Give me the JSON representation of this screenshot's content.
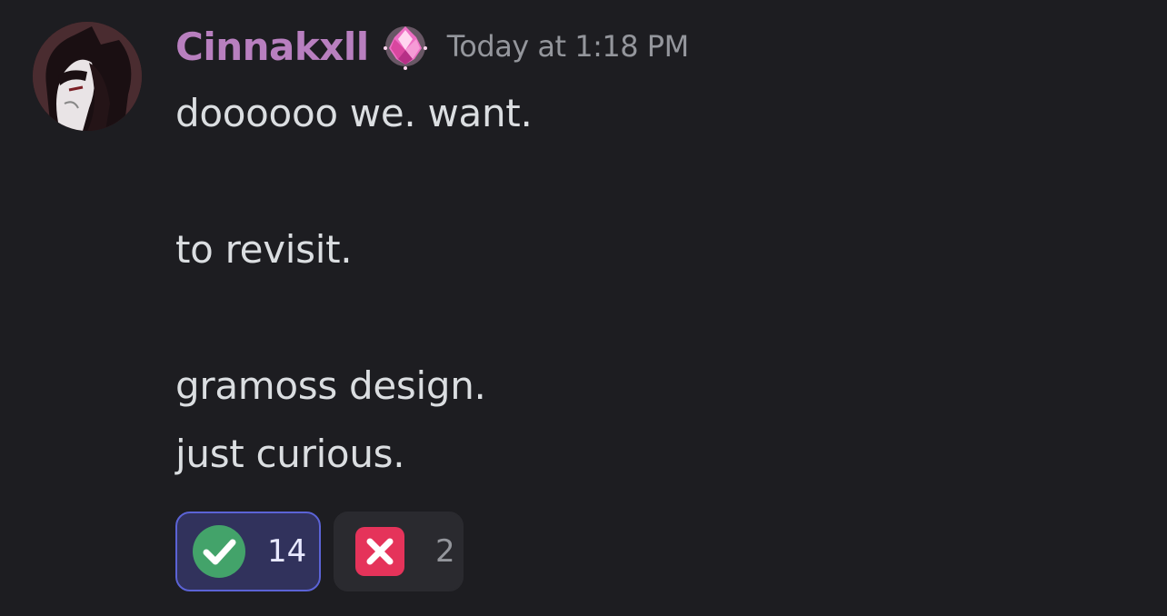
{
  "message": {
    "author": "Cinnakxll",
    "timestamp": "Today at 1:18 PM",
    "lines": [
      "doooooo we. want.",
      "to revisit.",
      "gramoss design.",
      "just curious."
    ],
    "author_color": "#b87fbf",
    "badge_icon": "pink-crystal-badge-icon"
  },
  "reactions": [
    {
      "emoji": "check-mark-icon",
      "count": "14",
      "active": true,
      "color": "#43a36a"
    },
    {
      "emoji": "cross-mark-icon",
      "count": "2",
      "active": false,
      "color": "#e5335a"
    }
  ]
}
